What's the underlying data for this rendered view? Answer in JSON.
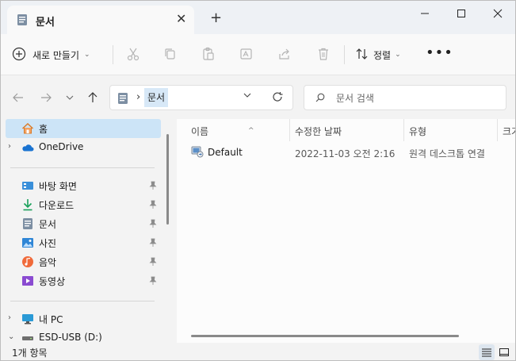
{
  "window": {
    "tab_title": "문서",
    "tab_icon": "documents-folder-icon",
    "controls": [
      "minimize",
      "maximize",
      "close"
    ]
  },
  "toolbar": {
    "new_label": "새로 만들기",
    "sort_label": "정렬",
    "actions": [
      "cut",
      "copy",
      "paste",
      "rename",
      "share",
      "delete",
      "more"
    ]
  },
  "address": {
    "crumb": "문서",
    "search_placeholder": "문서 검색"
  },
  "sidebar": {
    "items": [
      {
        "label": "홈",
        "icon": "home-icon",
        "selected": true
      },
      {
        "label": "OneDrive",
        "icon": "onedrive-cloud-icon",
        "expandable": true
      },
      {
        "label": "바탕 화면",
        "icon": "desktop-folder-icon",
        "pinned": true
      },
      {
        "label": "다운로드",
        "icon": "download-icon",
        "pinned": true
      },
      {
        "label": "문서",
        "icon": "documents-icon",
        "pinned": true
      },
      {
        "label": "사진",
        "icon": "pictures-icon",
        "pinned": true
      },
      {
        "label": "음악",
        "icon": "music-icon",
        "pinned": true
      },
      {
        "label": "동영상",
        "icon": "videos-icon",
        "pinned": true
      },
      {
        "label": "내 PC",
        "icon": "this-pc-icon",
        "expandable": true
      },
      {
        "label": "ESD-USB (D:)",
        "icon": "usb-drive-icon",
        "expanded": true
      }
    ]
  },
  "columns": [
    "이름",
    "수정한 날짜",
    "유형",
    "크기"
  ],
  "files": [
    {
      "name": "Default",
      "modified": "2022-11-03 오전 2:16",
      "type": "원격 데스크톱 연결",
      "icon": "rdp-file-icon"
    }
  ],
  "status": {
    "item_count": "1개 항목"
  },
  "colors": {
    "selected_bg": "#cce4f7",
    "accent": "#0067c0"
  }
}
